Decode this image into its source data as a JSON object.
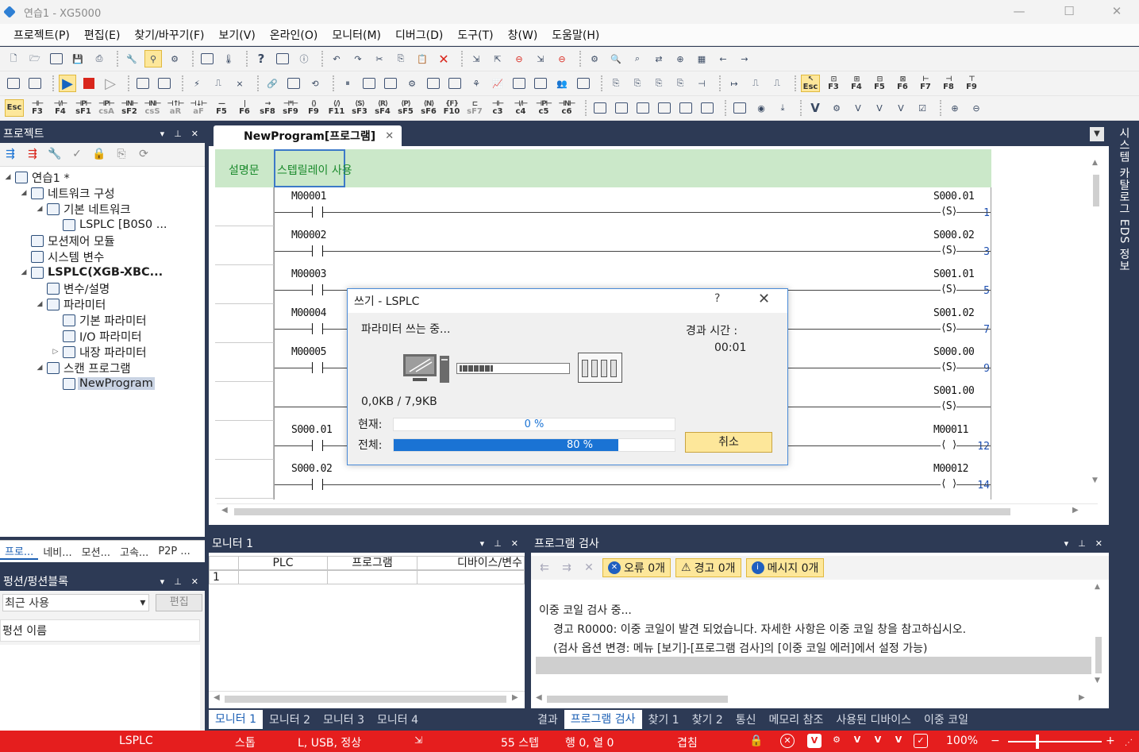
{
  "window": {
    "title": "연습1 - XG5000",
    "minimize": "—",
    "maximize": "☐",
    "close": "✕"
  },
  "menu": [
    "프로젝트(P)",
    "편집(E)",
    "찾기/바꾸기(F)",
    "보기(V)",
    "온라인(O)",
    "모니터(M)",
    "디버그(D)",
    "도구(T)",
    "창(W)",
    "도움말(H)"
  ],
  "fkeys": [
    {
      "sym": "",
      "key": "Esc"
    },
    {
      "sym": "⊣⊢",
      "key": "F3"
    },
    {
      "sym": "⊣/⊢",
      "key": "F4"
    },
    {
      "sym": "⊣P⊢",
      "key": "sF1"
    },
    {
      "sym": "⊣P⊢",
      "key": "csA"
    },
    {
      "sym": "⊣N⊢",
      "key": "sF2"
    },
    {
      "sym": "⊣N⊢",
      "key": "csS"
    },
    {
      "sym": "⊣↑⊢",
      "key": "aR"
    },
    {
      "sym": "⊣↓⊢",
      "key": "aF"
    },
    {
      "sym": "—",
      "key": "F5"
    },
    {
      "sym": "|",
      "key": "F6"
    },
    {
      "sym": "→",
      "key": "sF8"
    },
    {
      "sym": "⊣*⊢",
      "key": "sF9"
    },
    {
      "sym": "⟨⟩",
      "key": "F9"
    },
    {
      "sym": "⟨/⟩",
      "key": "F11"
    },
    {
      "sym": "⟨S⟩",
      "key": "sF3"
    },
    {
      "sym": "⟨R⟩",
      "key": "sF4"
    },
    {
      "sym": "⟨P⟩",
      "key": "sF5"
    },
    {
      "sym": "⟨N⟩",
      "key": "sF6"
    },
    {
      "sym": "{F}",
      "key": "F10"
    },
    {
      "sym": "⊏",
      "key": "sF7"
    },
    {
      "sym": "⊣⊢",
      "key": "c3"
    },
    {
      "sym": "⊣/⊢",
      "key": "c4"
    },
    {
      "sym": "⊣P⊢",
      "key": "c5"
    },
    {
      "sym": "⊣N⊢",
      "key": "c6"
    }
  ],
  "fkeys2": [
    "Esc",
    "F3",
    "F4",
    "F5",
    "F6",
    "F7",
    "F8",
    "F9"
  ],
  "project_panel": {
    "title": "프로젝트",
    "tree": [
      {
        "label": "연습1 *",
        "level": 0,
        "toggle": "◢"
      },
      {
        "label": "네트워크 구성",
        "level": 1,
        "toggle": "◢"
      },
      {
        "label": "기본 네트워크",
        "level": 2,
        "toggle": "◢"
      },
      {
        "label": "LSPLC [B0S0 ...",
        "level": 3,
        "toggle": ""
      },
      {
        "label": "모션제어 모듈",
        "level": 1,
        "toggle": ""
      },
      {
        "label": "시스템 변수",
        "level": 1,
        "toggle": ""
      },
      {
        "label": "LSPLC(XGB-XBC...",
        "level": 1,
        "toggle": "◢",
        "bold": true
      },
      {
        "label": "변수/설명",
        "level": 2,
        "toggle": ""
      },
      {
        "label": "파라미터",
        "level": 2,
        "toggle": "◢"
      },
      {
        "label": "기본 파라미터",
        "level": 3,
        "toggle": ""
      },
      {
        "label": "I/O 파라미터",
        "level": 3,
        "toggle": ""
      },
      {
        "label": "내장 파라미터",
        "level": 3,
        "toggle": "▷"
      },
      {
        "label": "스캔 프로그램",
        "level": 2,
        "toggle": "◢"
      },
      {
        "label": "NewProgram",
        "level": 3,
        "toggle": "",
        "selected": true
      }
    ],
    "tabs": [
      "프로...",
      "네비...",
      "모션...",
      "고속...",
      "P2P ..."
    ]
  },
  "function_panel": {
    "title": "펑션/펑션블록",
    "combo": "최근 사용",
    "combo_arrow": "▾",
    "edit": "편집",
    "header": "펑션 이름"
  },
  "document": {
    "tab": "NewProgram[프로그램]",
    "tab_close": "✕",
    "comment_label": "설명문",
    "comment_text": "스텝릴레이 사용",
    "rungs": [
      {
        "num": "1",
        "contact": "M00001",
        "coil": "S000.01",
        "coil_type": "S"
      },
      {
        "num": "3",
        "contact": "M00002",
        "coil": "S000.02",
        "coil_type": "S"
      },
      {
        "num": "5",
        "contact": "M00003",
        "coil": "S001.01",
        "coil_type": "S"
      },
      {
        "num": "7",
        "contact": "M00004",
        "coil": "S001.02",
        "coil_type": "S"
      },
      {
        "num": "9",
        "contact": "M00005",
        "coil": "S000.00",
        "coil_type": "S"
      },
      {
        "num": "",
        "contact": "",
        "coil": "S001.00",
        "coil_type": "S"
      },
      {
        "num": "12",
        "contact": "S000.01",
        "coil": "M00011",
        "coil_type": ""
      },
      {
        "num": "14",
        "contact": "S000.02",
        "coil": "M00012",
        "coil_type": ""
      }
    ]
  },
  "right_sidebar": "시스템 카탈로그 EDS 정보",
  "monitor": {
    "title": "모니터 1",
    "cols": [
      "PLC",
      "프로그램",
      "디바이스/변수"
    ],
    "row1": "1",
    "tabs": [
      "모니터 1",
      "모니터 2",
      "모니터 3",
      "모니터 4"
    ]
  },
  "program_check": {
    "title": "프로그램 검사",
    "errors": "오류 0개",
    "warnings": "경고 0개",
    "messages": "메시지 0개",
    "lines": [
      "이중 코일 검사 중...",
      "경고 R0000: 이중 코일이 발견 되었습니다. 자세한 사항은 이중 코일 창을 참고하십시오.",
      "(검사 옵션 변경: 메뉴 [보기]-[프로그램 검사]의 [이중 코일 에러]에서 설정 가능)"
    ],
    "tabs": [
      "결과",
      "프로그램 검사",
      "찾기 1",
      "찾기 2",
      "통신",
      "메모리 참조",
      "사용된 디바이스",
      "이중 코일"
    ]
  },
  "dialog": {
    "title": "쓰기 - LSPLC",
    "help": "?",
    "close": "✕",
    "status": "파라미터 쓰는 중...",
    "elapsed_label": "경과 시간 :",
    "elapsed": "00:01",
    "size": "0,0KB / 7,9KB",
    "current_label": "현재:",
    "current_pct": 0,
    "current_text": "0 %",
    "total_label": "전체:",
    "total_pct": 80,
    "total_text": "80 %",
    "cancel": "취소"
  },
  "status": {
    "plc": "LSPLC",
    "mode": "스톱",
    "conn": "L, USB, 정상",
    "steps": "55 스텝",
    "pos": "행 0, 열 0",
    "ovr": "겹침",
    "zoom": "100%",
    "minus": "−",
    "plus": "+"
  },
  "colors": {
    "accent": "#1a73d4",
    "panel": "#2d3a55",
    "status": "#e51e1e",
    "highlight": "#fde79a",
    "comment": "#cbe8c9"
  }
}
